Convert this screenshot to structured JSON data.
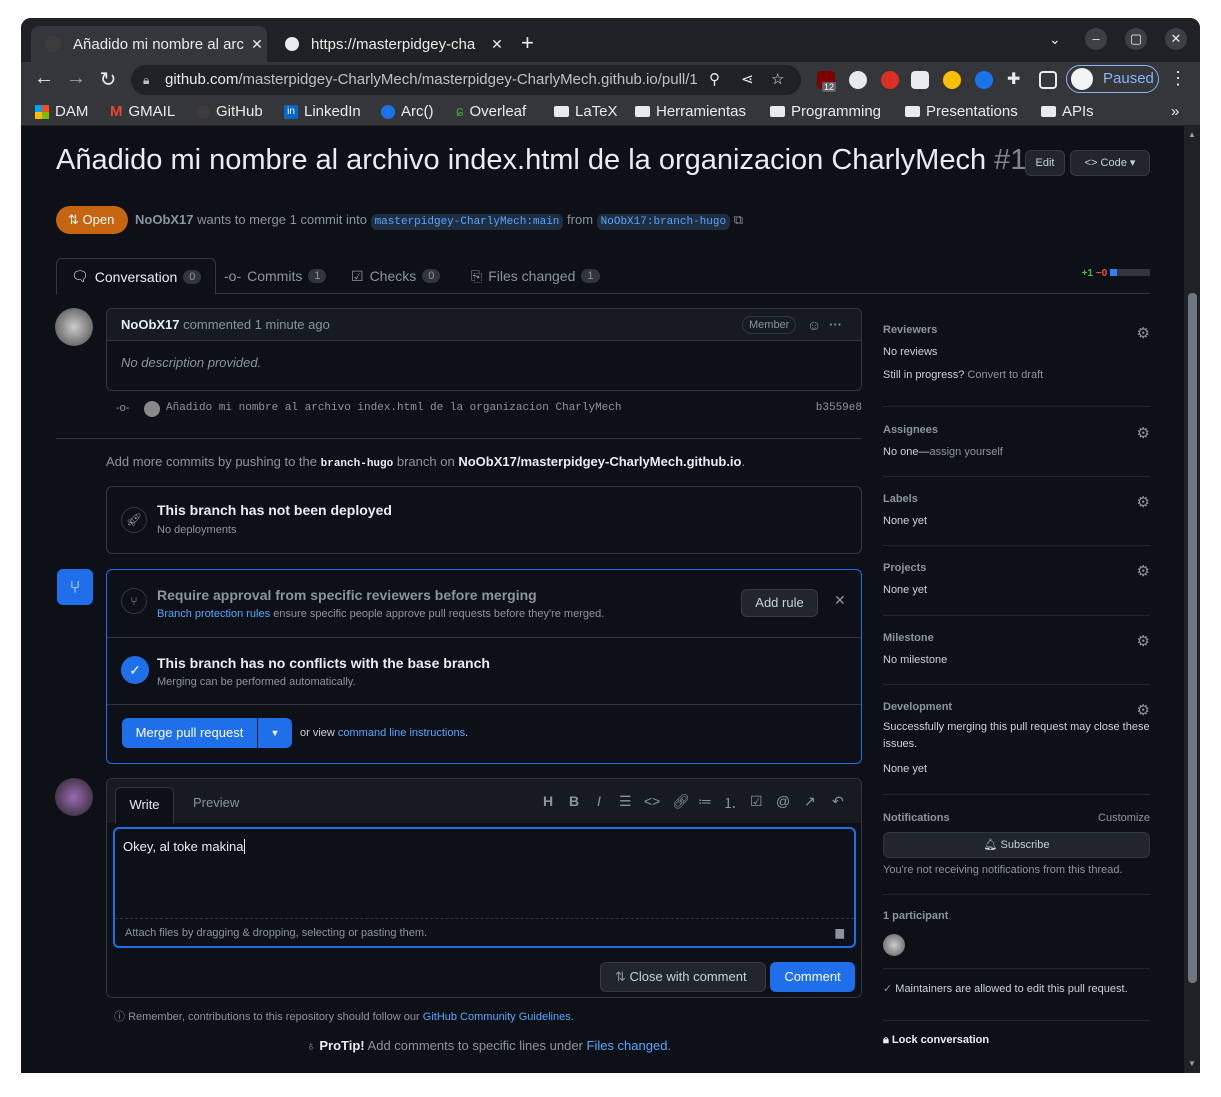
{
  "browser": {
    "tabs": [
      {
        "title": "Añadido mi nombre al arc"
      },
      {
        "title": "https://masterpidgey-cha"
      }
    ],
    "url_host": "github.com",
    "url_path": "/masterpidgey-CharlyMech/masterpidgey-CharlyMech.github.io/pull/1",
    "profile_status": "Paused",
    "ext_badge": "12",
    "bookmarks": [
      "DAM",
      "GMAIL",
      "GitHub",
      "LinkedIn",
      "Arc()",
      "Overleaf",
      "LaTeX",
      "Herramientas",
      "Programming",
      "Presentations",
      "APIs"
    ]
  },
  "pr": {
    "title": "Añadido mi nombre al archivo index.html de la organizacion CharlyMech",
    "number": "#1",
    "edit_label": "Edit",
    "code_label": "Code",
    "state": "Open",
    "author": "NoObX17",
    "merge_text": "wants to merge 1 commit into",
    "base_branch": "masterpidgey-CharlyMech:main",
    "from_text": "from",
    "head_branch": "NoObX17:branch-hugo",
    "diffstat_add": "+1",
    "diffstat_del": "−0"
  },
  "tabs": [
    {
      "label": "Conversation",
      "count": "0"
    },
    {
      "label": "Commits",
      "count": "1"
    },
    {
      "label": "Checks",
      "count": "0"
    },
    {
      "label": "Files changed",
      "count": "1"
    }
  ],
  "comment": {
    "author": "NoObX17",
    "meta": "commented 1 minute ago",
    "badge": "Member",
    "body": "No description provided."
  },
  "commit": {
    "message": "Añadido mi nombre al archivo index.html de la organizacion CharlyMech",
    "sha": "b3559e8"
  },
  "push_note": {
    "pre": "Add more commits by pushing to the",
    "branch": "branch-hugo",
    "mid": "branch on",
    "repo": "NoObX17/masterpidgey-CharlyMech.github.io",
    "end": "."
  },
  "deploy": {
    "title": "This branch has not been deployed",
    "sub": "No deployments"
  },
  "merge_box": {
    "rule_title": "Require approval from specific reviewers before merging",
    "rule_link": "Branch protection rules",
    "rule_text": "ensure specific people approve pull requests before they're merged.",
    "add_rule": "Add rule",
    "conflict_title": "This branch has no conflicts with the base branch",
    "conflict_sub": "Merging can be performed automatically.",
    "merge_button": "Merge pull request",
    "or_view": "or view",
    "cli_link": "command line instructions",
    "cli_end": "."
  },
  "editor": {
    "write_tab": "Write",
    "preview_tab": "Preview",
    "value": "Okey, al toke makina",
    "attach_hint": "Attach files by dragging & dropping, selecting or pasting them.",
    "close_button": "Close with comment",
    "comment_button": "Comment"
  },
  "footer": {
    "guidelines_pre": "Remember, contributions to this repository should follow our",
    "guidelines_link": "GitHub Community Guidelines",
    "guidelines_end": ".",
    "protip_label": "ProTip!",
    "protip_text": "Add comments to specific lines under",
    "protip_link": "Files changed",
    "protip_end": "."
  },
  "sidebar": {
    "reviewers": {
      "title": "Reviewers",
      "value": "No reviews",
      "draft_q": "Still in progress?",
      "draft_link": "Convert to draft"
    },
    "assignees": {
      "title": "Assignees",
      "value": "No one—",
      "link": "assign yourself"
    },
    "labels": {
      "title": "Labels",
      "value": "None yet"
    },
    "projects": {
      "title": "Projects",
      "value": "None yet"
    },
    "milestone": {
      "title": "Milestone",
      "value": "No milestone"
    },
    "development": {
      "title": "Development",
      "text": "Successfully merging this pull request may close these issues.",
      "value": "None yet"
    },
    "notifications": {
      "title": "Notifications",
      "customize": "Customize",
      "subscribe": "Subscribe",
      "note": "You're not receiving notifications from this thread."
    },
    "participants": {
      "title": "1 participant"
    },
    "maintainers": "Maintainers are allowed to edit this pull request.",
    "lock": "Lock conversation"
  }
}
